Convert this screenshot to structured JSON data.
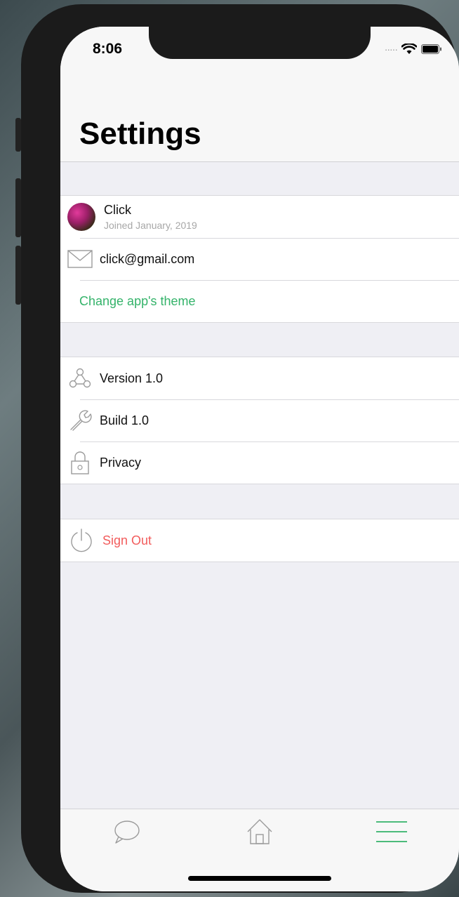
{
  "status": {
    "time": "8:06"
  },
  "header": {
    "title": "Settings"
  },
  "profile": {
    "name": "Click",
    "joined": "Joined January, 2019"
  },
  "account": {
    "email": "click@gmail.com",
    "theme_link": "Change app's theme"
  },
  "info": {
    "version": "Version 1.0",
    "build": "Build 1.0",
    "privacy": "Privacy"
  },
  "signout": {
    "label": "Sign Out"
  },
  "icons": {
    "avatar": "avatar-image",
    "email": "envelope-icon",
    "version": "network-icon",
    "build": "wrench-icon",
    "privacy": "lock-icon",
    "signout": "power-icon",
    "tab_chat": "chat-bubble-icon",
    "tab_home": "home-icon",
    "tab_menu": "menu-icon"
  },
  "colors": {
    "accent": "#34b36a",
    "danger": "#f25c5c",
    "muted": "#a7a7a7"
  }
}
